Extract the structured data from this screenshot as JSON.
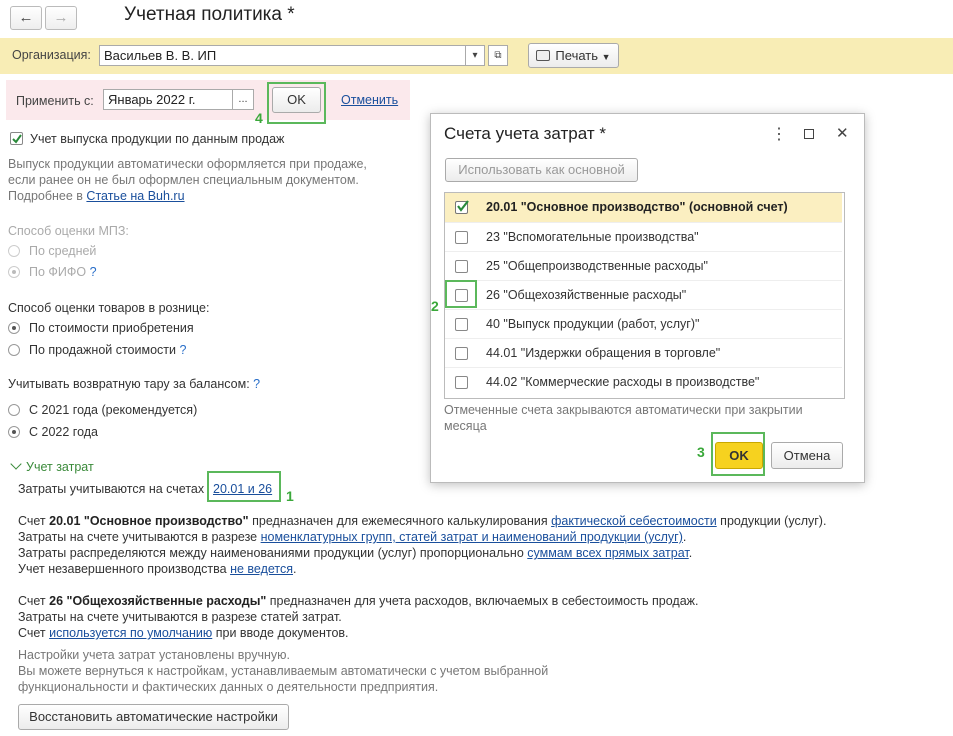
{
  "window": {
    "title": "Учетная политика *",
    "back_icon": "arrow-left",
    "forward_icon": "arrow-right"
  },
  "org": {
    "label": "Организация:",
    "value": "Васильев В. В. ИП",
    "dropdown_glyph": "▾",
    "open_glyph": "⧉",
    "print_label": "Печать",
    "print_icon": "printer-icon"
  },
  "apply": {
    "label": "Применить с:",
    "value": "Январь 2022 г.",
    "picker": "...",
    "ok": "OK",
    "cancel": "Отменить",
    "marker": "4"
  },
  "production": {
    "checkbox_label": "Учет выпуска продукции по данным продаж",
    "note1": "Выпуск продукции автоматически оформляется при продаже,",
    "note2": "если ранее он не был оформлен специальным документом.",
    "more_prefix": "Подробнее в ",
    "more_link": "Статье на Buh.ru"
  },
  "mpz": {
    "title": "Способ оценки МПЗ:",
    "opt1": "По средней",
    "opt2": "По ФИФО",
    "help": "?"
  },
  "retail": {
    "title": "Способ оценки товаров в рознице:",
    "opt1": "По стоимости приобретения",
    "opt2": "По продажной стоимости",
    "help": "?"
  },
  "tare": {
    "title": "Учитывать возвратную тару за балансом:",
    "help": "?",
    "opt1": "С 2021 года (рекомендуется)",
    "opt2": "С 2022 года"
  },
  "costs": {
    "section_title": "Учет затрат",
    "chevron": "⌄",
    "accounts_prefix": "Затраты учитываются на счетах",
    "accounts_link": "20.01 и 26",
    "marker": "1",
    "p1": {
      "l1_pre": "Счет ",
      "l1_bold": "20.01 \"Основное производство\"",
      "l1_mid": " предназначен для ежемесячного калькулирования ",
      "l1_link": "фактической себестоимости",
      "l1_post": " продукции (услуг).",
      "l2_pre": "Затраты на счете учитываются в разрезе ",
      "l2_link": "номенклатурных групп, статей затрат и наименований продукции (услуг)",
      "l2_post": ".",
      "l3_pre": "Затраты распределяются между наименованиями продукции (услуг) пропорционально ",
      "l3_link": "суммам всех прямых затрат",
      "l3_post": ".",
      "l4_pre": "Учет незавершенного производства ",
      "l4_link": "не ведется",
      "l4_post": "."
    },
    "p2": {
      "l1_pre": "Счет ",
      "l1_bold": "26 \"Общехозяйственные расходы\"",
      "l1_post": " предназначен для учета расходов, включаемых в себестоимость продаж.",
      "l2": "Затраты на счете учитываются в разрезе статей затрат.",
      "l3_pre": "Счет ",
      "l3_link": "используется по умолчанию",
      "l3_post": " при вводе документов."
    },
    "manual1": "Настройки учета затрат установлены вручную.",
    "manual2": "Вы можете вернуться к настройкам, устанавливаемым автоматически с учетом выбранной",
    "manual3": "функциональности и фактических данных о деятельности предприятия.",
    "restore": "Восстановить автоматические настройки"
  },
  "dialog": {
    "title": "Счета учета затрат *",
    "use_as_main": "Использовать как основной",
    "accounts": [
      {
        "label": "20.01 \"Основное производство\" (основной счет)",
        "checked": true
      },
      {
        "label": "23 \"Вспомогательные производства\"",
        "checked": false
      },
      {
        "label": "25 \"Общепроизводственные расходы\"",
        "checked": false
      },
      {
        "label": "26 \"Общехозяйственные расходы\"",
        "checked": false
      },
      {
        "label": "40 \"Выпуск продукции (работ, услуг)\"",
        "checked": false
      },
      {
        "label": "44.01 \"Издержки обращения в торговле\"",
        "checked": false
      },
      {
        "label": "44.02 \"Коммерческие расходы в производстве\"",
        "checked": false
      }
    ],
    "note1": "Отмеченные счета закрываются автоматически при закрытии",
    "note2": "месяца",
    "ok": "OK",
    "cancel": "Отмена",
    "marker_row": "2",
    "marker_ok": "3",
    "menu_glyph": "⋮",
    "max_glyph": "☐",
    "close_glyph": "✕"
  },
  "colors": {
    "org_bar": "#f8edb5",
    "apply_bar": "#fbe9ec",
    "highlight_frame": "#5bb85b",
    "ok_button": "#f6d21f",
    "selected_row": "#fbefc1",
    "link": "#1a4f9c"
  }
}
